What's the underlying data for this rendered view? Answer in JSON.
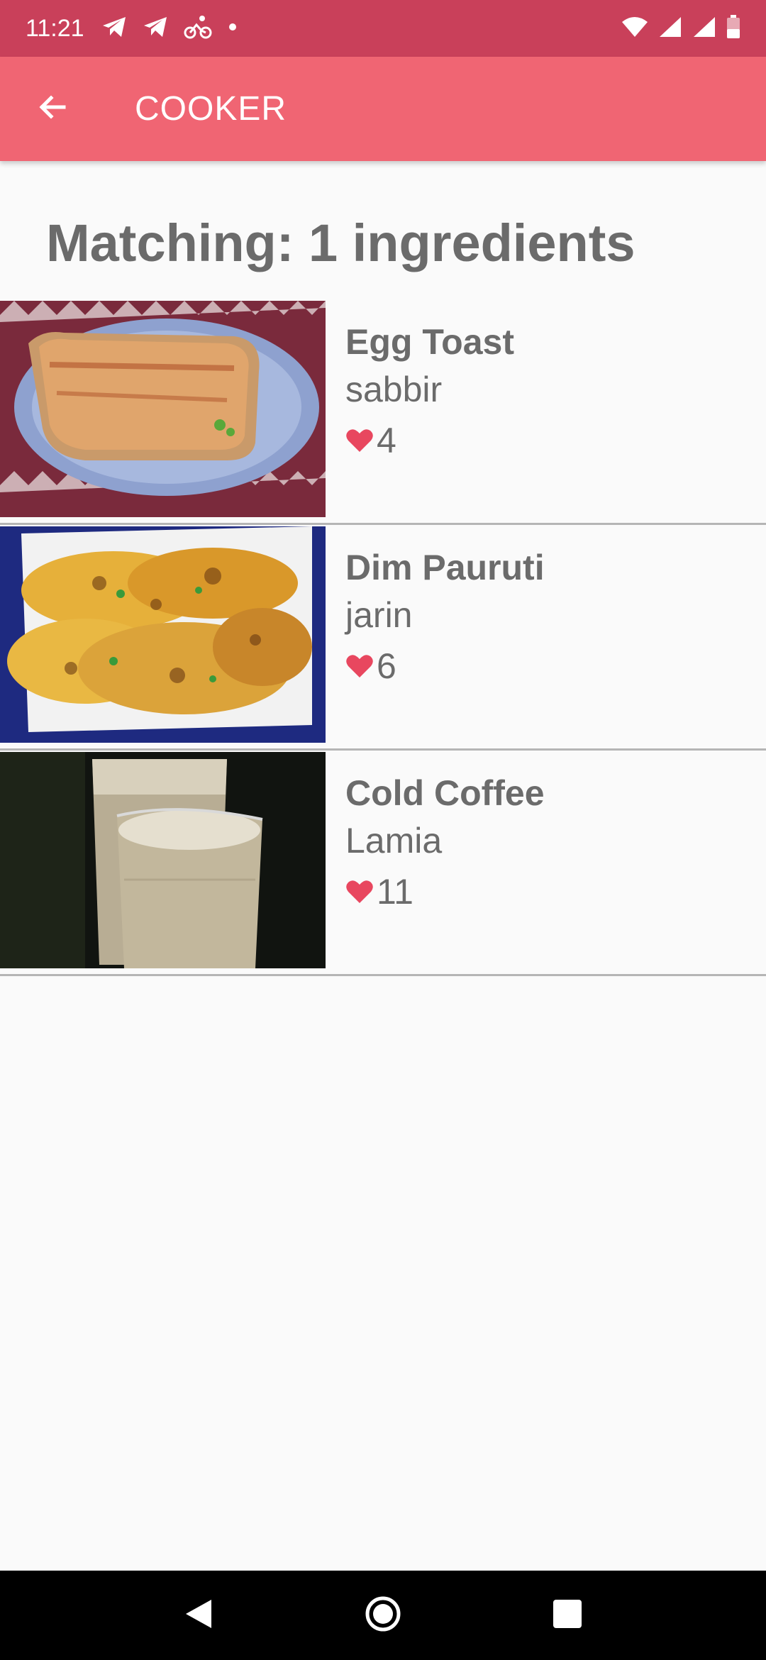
{
  "status_bar": {
    "time": "11:21",
    "left_icons": [
      "telegram-icon",
      "telegram-icon",
      "cycling-icon",
      "dot-icon"
    ],
    "right_icons": [
      "wifi-icon",
      "signal-icon",
      "signal-icon",
      "battery-icon"
    ],
    "color": "#c9405a"
  },
  "app_bar": {
    "title": "COOKER",
    "back_icon": "arrow-left-icon",
    "color": "#f06573"
  },
  "heading": "Matching: 1 ingredients",
  "recipes": [
    {
      "name": "Egg Toast",
      "author": "sabbir",
      "likes": "4",
      "image": "egg-toast-photo"
    },
    {
      "name": "Dim Pauruti",
      "author": "jarin",
      "likes": "6",
      "image": "dim-pauruti-photo"
    },
    {
      "name": "Cold Coffee",
      "author": "Lamia",
      "likes": "11",
      "image": "cold-coffee-photo"
    }
  ],
  "accent": {
    "heart": "#e8475f"
  },
  "nav_bar": {
    "buttons": [
      "back-triangle-icon",
      "home-circle-icon",
      "recents-square-icon"
    ]
  }
}
